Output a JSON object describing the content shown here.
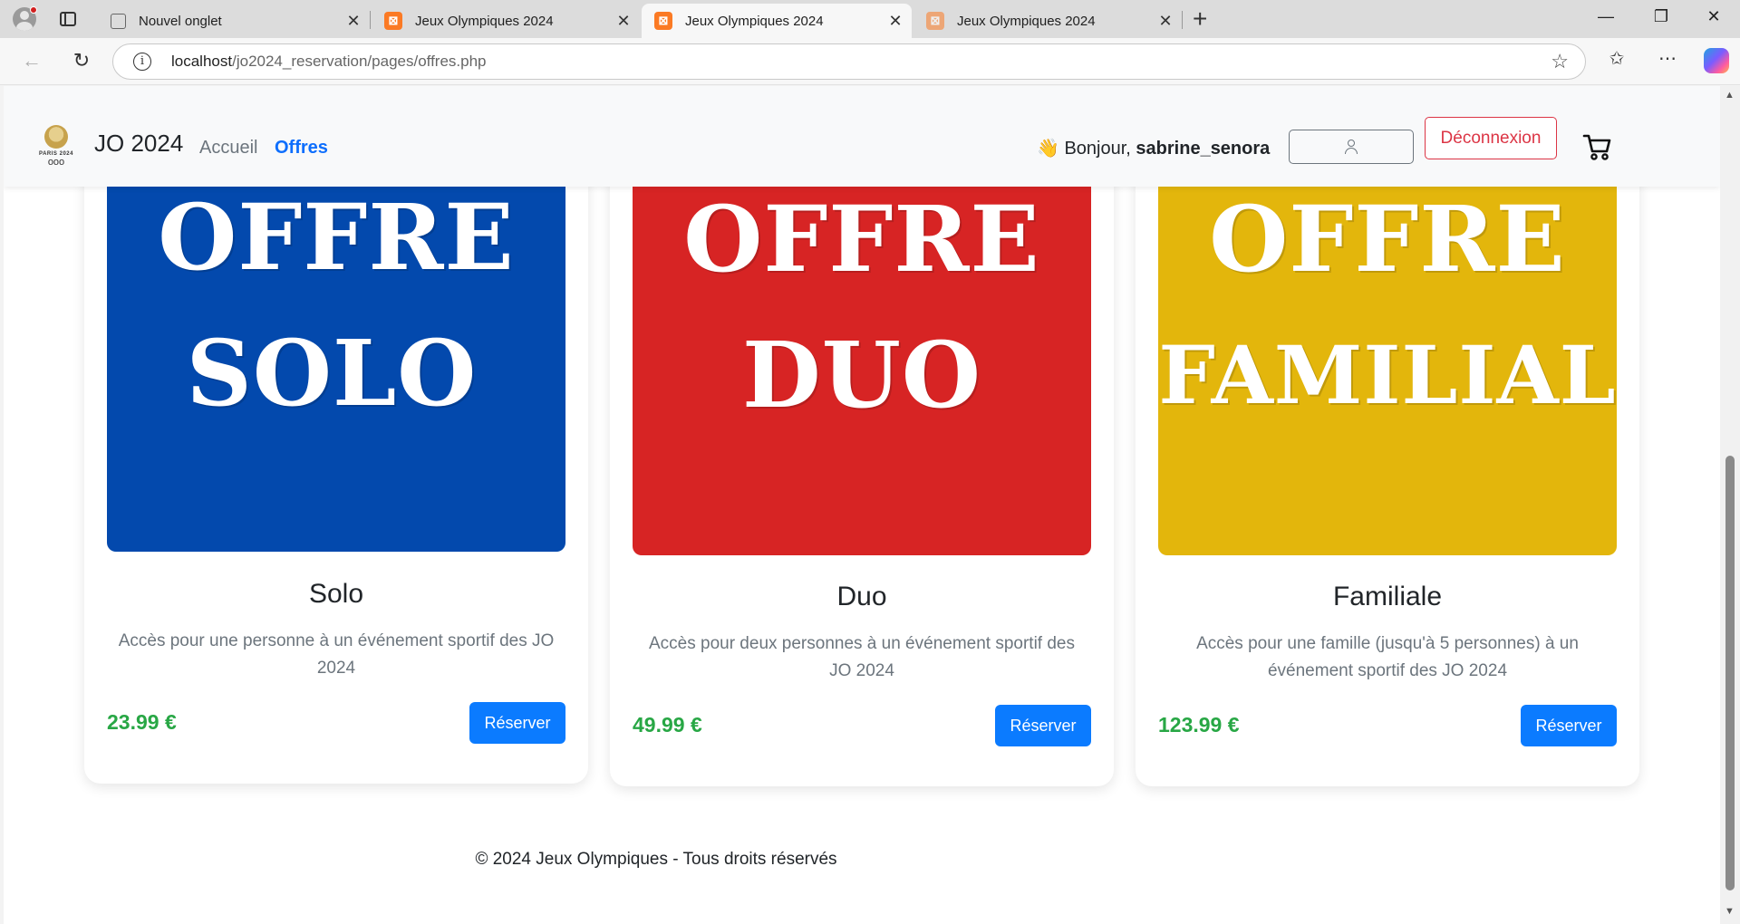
{
  "browser": {
    "tabs": [
      {
        "title": "Nouvel onglet"
      },
      {
        "title": "Jeux Olympiques 2024"
      },
      {
        "title": "Jeux Olympiques 2024"
      },
      {
        "title": "Jeux Olympiques 2024"
      }
    ],
    "url_host": "localhost",
    "url_path": "/jo2024_reservation/pages/offres.php"
  },
  "navbar": {
    "logo_text": "PARIS 2024",
    "brand": "JO 2024",
    "links": [
      {
        "label": "Accueil"
      },
      {
        "label": "Offres"
      }
    ],
    "greeting_emoji": "👋",
    "greeting": "Bonjour,",
    "username": "sabrine_senora",
    "logout_label": "Déconnexion"
  },
  "offers": [
    {
      "image_line1": "OFFRE",
      "image_line2": "SOLO",
      "image_color": "#0349ad",
      "title": "Solo",
      "description": "Accès pour une personne à un événement sportif des JO 2024",
      "price": "23.99 €",
      "button": "Réserver"
    },
    {
      "image_line1": "OFFRE",
      "image_line2": "DUO",
      "image_color": "#d72424",
      "title": "Duo",
      "description": "Accès pour deux personnes à un événement sportif des JO 2024",
      "price": "49.99 €",
      "button": "Réserver"
    },
    {
      "image_line1": "OFFRE",
      "image_line2": "FAMILIAL",
      "image_color": "#e3b60c",
      "title": "Familiale",
      "description": "Accès pour une famille (jusqu'à 5 personnes) à un événement sportif des JO 2024",
      "price": "123.99 €",
      "button": "Réserver"
    }
  ],
  "footer": "© 2024 Jeux Olympiques - Tous droits réservés",
  "colors": {
    "primary": "#0b7bff",
    "price": "#28a745",
    "danger": "#dc3545",
    "nav_active": "#0d6efd"
  }
}
